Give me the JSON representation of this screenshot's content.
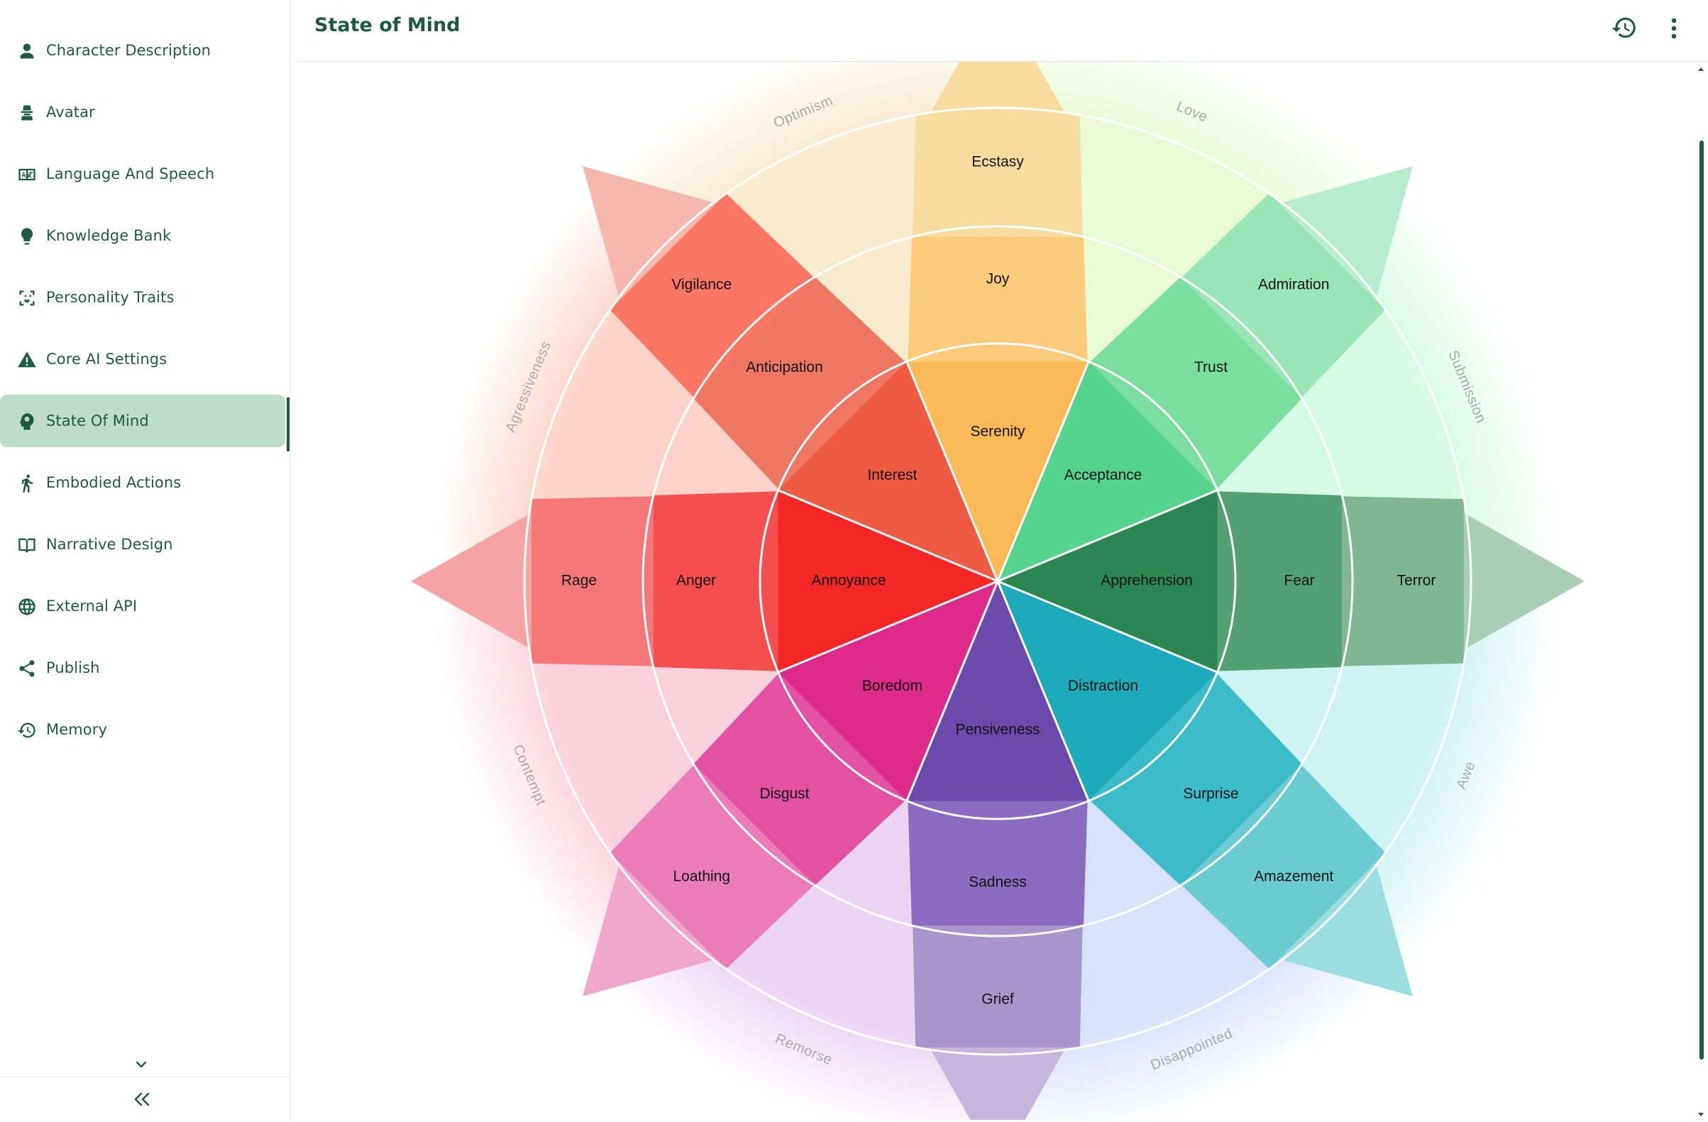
{
  "header": {
    "title": "State of Mind",
    "history_icon": "history-icon",
    "more_icon": "more-vertical-icon"
  },
  "sidebar": {
    "items": [
      {
        "label": "Character Description",
        "icon": "person-icon"
      },
      {
        "label": "Avatar",
        "icon": "avatar-icon"
      },
      {
        "label": "Language And Speech",
        "icon": "language-icon"
      },
      {
        "label": "Knowledge Bank",
        "icon": "lightbulb-icon"
      },
      {
        "label": "Personality Traits",
        "icon": "face-scan-icon"
      },
      {
        "label": "Core AI Settings",
        "icon": "warning-icon"
      },
      {
        "label": "State Of Mind",
        "icon": "brain-head-icon",
        "active": true
      },
      {
        "label": "Embodied Actions",
        "icon": "running-icon"
      },
      {
        "label": "Narrative Design",
        "icon": "book-icon"
      },
      {
        "label": "External API",
        "icon": "globe-icon"
      },
      {
        "label": "Publish",
        "icon": "share-icon"
      },
      {
        "label": "Memory",
        "icon": "history-icon"
      }
    ],
    "expand_icon": "chevron-down-icon",
    "collapse_icon": "double-chevron-left-icon"
  },
  "wheel": {
    "petals": [
      {
        "name": "joy",
        "inner": "Serenity",
        "middle": "Joy",
        "outer": "Ecstasy",
        "colors": [
          "#fbb957",
          "#fbcb7c",
          "#f9dba0"
        ]
      },
      {
        "name": "trust",
        "inner": "Acceptance",
        "middle": "Trust",
        "outer": "Admiration",
        "colors": [
          "#56d48e",
          "#7ade9f",
          "#99e5b6"
        ]
      },
      {
        "name": "fear",
        "inner": "Apprehension",
        "middle": "Fear",
        "outer": "Terror",
        "colors": [
          "#2a8751",
          "#52a073",
          "#7fb795"
        ]
      },
      {
        "name": "surprise",
        "inner": "Distraction",
        "middle": "Surprise",
        "outer": "Amazement",
        "colors": [
          "#1dabb9",
          "#3cbcc8",
          "#6bcbd3"
        ]
      },
      {
        "name": "sadness",
        "inner": "Pensiveness",
        "middle": "Sadness",
        "outer": "Grief",
        "colors": [
          "#6b4aab",
          "#8a6cc0",
          "#a795cc"
        ]
      },
      {
        "name": "disgust",
        "inner": "Boredom",
        "middle": "Disgust",
        "outer": "Loathing",
        "colors": [
          "#de2a8b",
          "#e251a2",
          "#ea7cb8"
        ]
      },
      {
        "name": "anger",
        "inner": "Annoyance",
        "middle": "Anger",
        "outer": "Rage",
        "colors": [
          "#f42727",
          "#f54e4e",
          "#f57777"
        ]
      },
      {
        "name": "anticipation",
        "inner": "Interest",
        "middle": "Anticipation",
        "outer": "Vigilance",
        "colors": [
          "#ee5a42",
          "#ee7763",
          "#fb7664"
        ]
      }
    ],
    "dyads": [
      "Love",
      "Submission",
      "Awe",
      "Disappointed",
      "Remorse",
      "Contempt",
      "Agressiveness",
      "Optimism"
    ],
    "dyad_colors": [
      "#e9fbd3",
      "#d5fbe6",
      "#cdf3f2",
      "#d7e1fb",
      "#ead4f1",
      "#fbd0dd",
      "#fdd3c7",
      "#f8eacc"
    ],
    "tip_colors": [
      "#f9dba0",
      "#b6ecd0",
      "#a8cfb5",
      "#9adee2",
      "#c5b5de",
      "#efa7cb",
      "#f7a3a3",
      "#f5b8ae"
    ]
  }
}
